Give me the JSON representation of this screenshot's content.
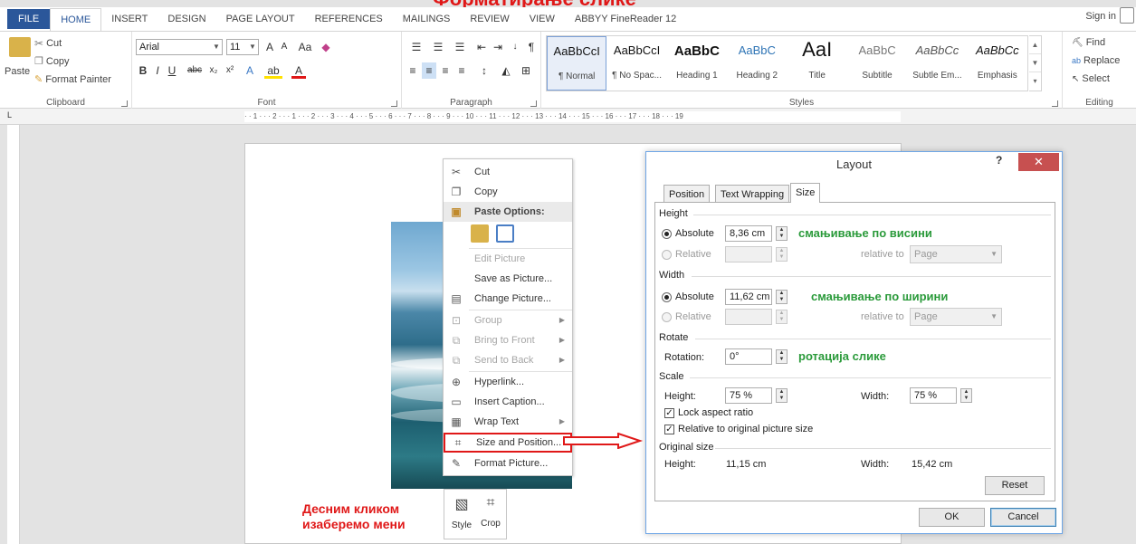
{
  "overlay": {
    "title": "Форматирање слике",
    "caption_line1": "Десним кликом",
    "caption_line2": "изаберемо мени"
  },
  "tabs": [
    "FILE",
    "HOME",
    "INSERT",
    "DESIGN",
    "PAGE LAYOUT",
    "REFERENCES",
    "MAILINGS",
    "REVIEW",
    "VIEW",
    "ABBYY FineReader 12"
  ],
  "signin": "Sign in",
  "ribbon": {
    "clipboard": {
      "label": "Clipboard",
      "paste": "Paste",
      "cut": "Cut",
      "copy": "Copy",
      "format_painter": "Format Painter"
    },
    "font": {
      "label": "Font",
      "family": "Arial",
      "size": "11"
    },
    "paragraph": {
      "label": "Paragraph"
    },
    "styles": {
      "label": "Styles",
      "items": [
        {
          "preview": "AaBbCcI",
          "name": "¶ Normal"
        },
        {
          "preview": "AaBbCcI",
          "name": "¶ No Spac..."
        },
        {
          "preview": "AaBbC",
          "name": "Heading 1"
        },
        {
          "preview": "AaBbC",
          "name": "Heading 2"
        },
        {
          "preview": "AaI",
          "name": "Title"
        },
        {
          "preview": "AaBbC",
          "name": "Subtitle"
        },
        {
          "preview": "AaBbCc",
          "name": "Subtle Em..."
        },
        {
          "preview": "AaBbCc",
          "name": "Emphasis"
        }
      ]
    },
    "editing": {
      "label": "Editing",
      "find": "Find",
      "replace": "Replace",
      "select": "Select"
    }
  },
  "ruler": {
    "corner": "L",
    "marks": "· · 1 · · · 2 · · · 1 · · · 2 · · · 3 · · · 4 · · · 5 · · · 6 · · · 7 · · · 8 · · · 9 · · · 10 · · · 11 · · · 12 · · · 13 · · · 14 · · · 15 · · · 16 · · · 17 · · · 18 · · · 19"
  },
  "context_menu": {
    "cut": "Cut",
    "copy": "Copy",
    "paste_options": "Paste Options:",
    "edit_picture": "Edit Picture",
    "save_as_picture": "Save as Picture...",
    "change_picture": "Change Picture...",
    "group": "Group",
    "bring_to_front": "Bring to Front",
    "send_to_back": "Send to Back",
    "hyperlink": "Hyperlink...",
    "insert_caption": "Insert Caption...",
    "wrap_text": "Wrap Text",
    "size_and_position": "Size and Position...",
    "format_picture": "Format Picture..."
  },
  "picture_toolbar": {
    "style": "Style",
    "crop": "Crop"
  },
  "dialog": {
    "title": "Layout",
    "help": "?",
    "tabs": [
      "Position",
      "Text Wrapping",
      "Size"
    ],
    "height_section": "Height",
    "absolute": "Absolute",
    "relative": "Relative",
    "height_abs_value": "8,36 cm",
    "relative_to": "relative to",
    "page": "Page",
    "width_section": "Width",
    "width_abs_value": "11,62 cm",
    "rotate_section": "Rotate",
    "rotation_label": "Rotation:",
    "rotation_value": "0°",
    "scale_section": "Scale",
    "scale_height_label": "Height:",
    "scale_height_value": "75 %",
    "scale_width_label": "Width:",
    "scale_width_value": "75 %",
    "lock_aspect": "Lock aspect ratio",
    "relative_original": "Relative to original picture size",
    "original_section": "Original size",
    "orig_height_label": "Height:",
    "orig_height_value": "11,15 cm",
    "orig_width_label": "Width:",
    "orig_width_value": "15,42 cm",
    "reset": "Reset",
    "ok": "OK",
    "cancel": "Cancel",
    "annot_height": "смањивање по висини",
    "annot_width": "смањивање по ширини",
    "annot_rotate": "ротација слике"
  }
}
